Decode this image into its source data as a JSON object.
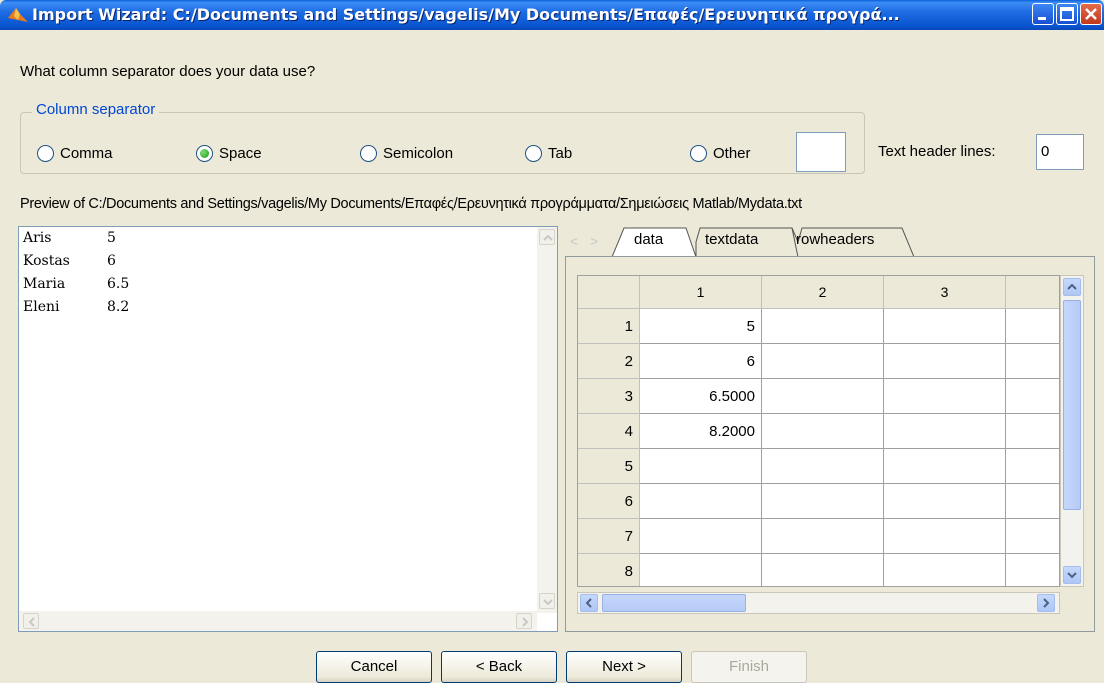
{
  "window": {
    "title": "Import Wizard: C:/Documents and Settings/vagelis/My Documents/Επαφές/Ερευνητικά προγρά...",
    "app_icon": "matlab-icon"
  },
  "prompt": "What column separator does your data use?",
  "separator": {
    "legend": "Column separator",
    "options": [
      "Comma",
      "Space",
      "Semicolon",
      "Tab",
      "Other"
    ],
    "selected": "Space",
    "other_value": ""
  },
  "header_lines": {
    "label": "Text header lines:",
    "value": "0"
  },
  "preview": {
    "label": "Preview of C:/Documents and Settings/vagelis/My Documents/Επαφές/Ερευνητικά προγράμματα/Σημειώσεις Matlab/Mydata.txt",
    "lines": [
      {
        "name": "Aris",
        "value": "5"
      },
      {
        "name": "Kostas",
        "value": "6"
      },
      {
        "name": "Maria",
        "value": "6.5"
      },
      {
        "name": "Eleni",
        "value": "8.2"
      }
    ]
  },
  "tabs": [
    "data",
    "textdata",
    "rowheaders"
  ],
  "active_tab": "data",
  "grid": {
    "columns": [
      "1",
      "2",
      "3"
    ],
    "rows": [
      "1",
      "2",
      "3",
      "4",
      "5",
      "6",
      "7",
      "8"
    ],
    "values": [
      "5",
      "6",
      "6.5000",
      "8.2000",
      "",
      "",
      "",
      ""
    ]
  },
  "buttons": {
    "cancel": "Cancel",
    "back": "< Back",
    "next": "Next >",
    "finish": "Finish"
  },
  "colors": {
    "title_bar": "#0a5ed8",
    "legend_text": "#0046d5",
    "radio_selected": "#1e9a23"
  }
}
